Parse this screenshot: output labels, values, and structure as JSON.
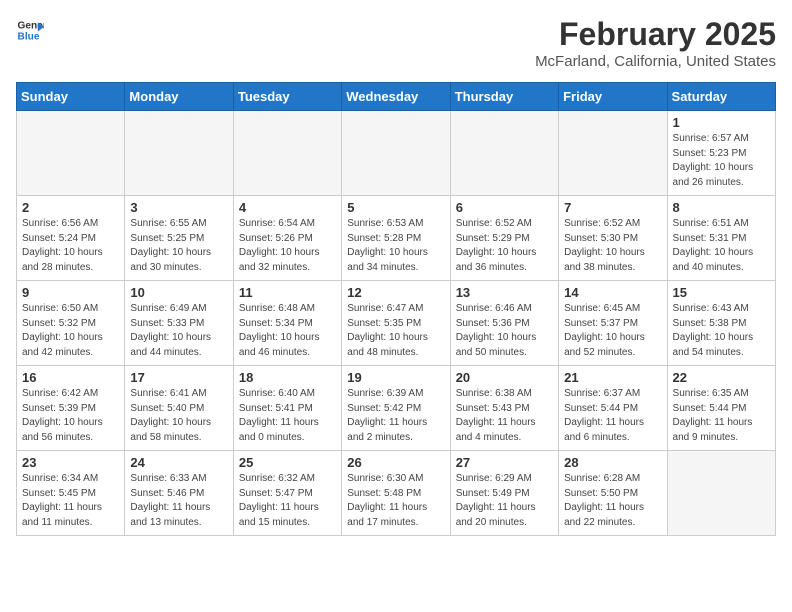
{
  "header": {
    "logo_line1": "General",
    "logo_line2": "Blue",
    "title": "February 2025",
    "subtitle": "McFarland, California, United States"
  },
  "days_of_week": [
    "Sunday",
    "Monday",
    "Tuesday",
    "Wednesday",
    "Thursday",
    "Friday",
    "Saturday"
  ],
  "weeks": [
    [
      {
        "day": "",
        "info": ""
      },
      {
        "day": "",
        "info": ""
      },
      {
        "day": "",
        "info": ""
      },
      {
        "day": "",
        "info": ""
      },
      {
        "day": "",
        "info": ""
      },
      {
        "day": "",
        "info": ""
      },
      {
        "day": "1",
        "info": "Sunrise: 6:57 AM\nSunset: 5:23 PM\nDaylight: 10 hours\nand 26 minutes."
      }
    ],
    [
      {
        "day": "2",
        "info": "Sunrise: 6:56 AM\nSunset: 5:24 PM\nDaylight: 10 hours\nand 28 minutes."
      },
      {
        "day": "3",
        "info": "Sunrise: 6:55 AM\nSunset: 5:25 PM\nDaylight: 10 hours\nand 30 minutes."
      },
      {
        "day": "4",
        "info": "Sunrise: 6:54 AM\nSunset: 5:26 PM\nDaylight: 10 hours\nand 32 minutes."
      },
      {
        "day": "5",
        "info": "Sunrise: 6:53 AM\nSunset: 5:28 PM\nDaylight: 10 hours\nand 34 minutes."
      },
      {
        "day": "6",
        "info": "Sunrise: 6:52 AM\nSunset: 5:29 PM\nDaylight: 10 hours\nand 36 minutes."
      },
      {
        "day": "7",
        "info": "Sunrise: 6:52 AM\nSunset: 5:30 PM\nDaylight: 10 hours\nand 38 minutes."
      },
      {
        "day": "8",
        "info": "Sunrise: 6:51 AM\nSunset: 5:31 PM\nDaylight: 10 hours\nand 40 minutes."
      }
    ],
    [
      {
        "day": "9",
        "info": "Sunrise: 6:50 AM\nSunset: 5:32 PM\nDaylight: 10 hours\nand 42 minutes."
      },
      {
        "day": "10",
        "info": "Sunrise: 6:49 AM\nSunset: 5:33 PM\nDaylight: 10 hours\nand 44 minutes."
      },
      {
        "day": "11",
        "info": "Sunrise: 6:48 AM\nSunset: 5:34 PM\nDaylight: 10 hours\nand 46 minutes."
      },
      {
        "day": "12",
        "info": "Sunrise: 6:47 AM\nSunset: 5:35 PM\nDaylight: 10 hours\nand 48 minutes."
      },
      {
        "day": "13",
        "info": "Sunrise: 6:46 AM\nSunset: 5:36 PM\nDaylight: 10 hours\nand 50 minutes."
      },
      {
        "day": "14",
        "info": "Sunrise: 6:45 AM\nSunset: 5:37 PM\nDaylight: 10 hours\nand 52 minutes."
      },
      {
        "day": "15",
        "info": "Sunrise: 6:43 AM\nSunset: 5:38 PM\nDaylight: 10 hours\nand 54 minutes."
      }
    ],
    [
      {
        "day": "16",
        "info": "Sunrise: 6:42 AM\nSunset: 5:39 PM\nDaylight: 10 hours\nand 56 minutes."
      },
      {
        "day": "17",
        "info": "Sunrise: 6:41 AM\nSunset: 5:40 PM\nDaylight: 10 hours\nand 58 minutes."
      },
      {
        "day": "18",
        "info": "Sunrise: 6:40 AM\nSunset: 5:41 PM\nDaylight: 11 hours\nand 0 minutes."
      },
      {
        "day": "19",
        "info": "Sunrise: 6:39 AM\nSunset: 5:42 PM\nDaylight: 11 hours\nand 2 minutes."
      },
      {
        "day": "20",
        "info": "Sunrise: 6:38 AM\nSunset: 5:43 PM\nDaylight: 11 hours\nand 4 minutes."
      },
      {
        "day": "21",
        "info": "Sunrise: 6:37 AM\nSunset: 5:44 PM\nDaylight: 11 hours\nand 6 minutes."
      },
      {
        "day": "22",
        "info": "Sunrise: 6:35 AM\nSunset: 5:44 PM\nDaylight: 11 hours\nand 9 minutes."
      }
    ],
    [
      {
        "day": "23",
        "info": "Sunrise: 6:34 AM\nSunset: 5:45 PM\nDaylight: 11 hours\nand 11 minutes."
      },
      {
        "day": "24",
        "info": "Sunrise: 6:33 AM\nSunset: 5:46 PM\nDaylight: 11 hours\nand 13 minutes."
      },
      {
        "day": "25",
        "info": "Sunrise: 6:32 AM\nSunset: 5:47 PM\nDaylight: 11 hours\nand 15 minutes."
      },
      {
        "day": "26",
        "info": "Sunrise: 6:30 AM\nSunset: 5:48 PM\nDaylight: 11 hours\nand 17 minutes."
      },
      {
        "day": "27",
        "info": "Sunrise: 6:29 AM\nSunset: 5:49 PM\nDaylight: 11 hours\nand 20 minutes."
      },
      {
        "day": "28",
        "info": "Sunrise: 6:28 AM\nSunset: 5:50 PM\nDaylight: 11 hours\nand 22 minutes."
      },
      {
        "day": "",
        "info": ""
      }
    ]
  ]
}
